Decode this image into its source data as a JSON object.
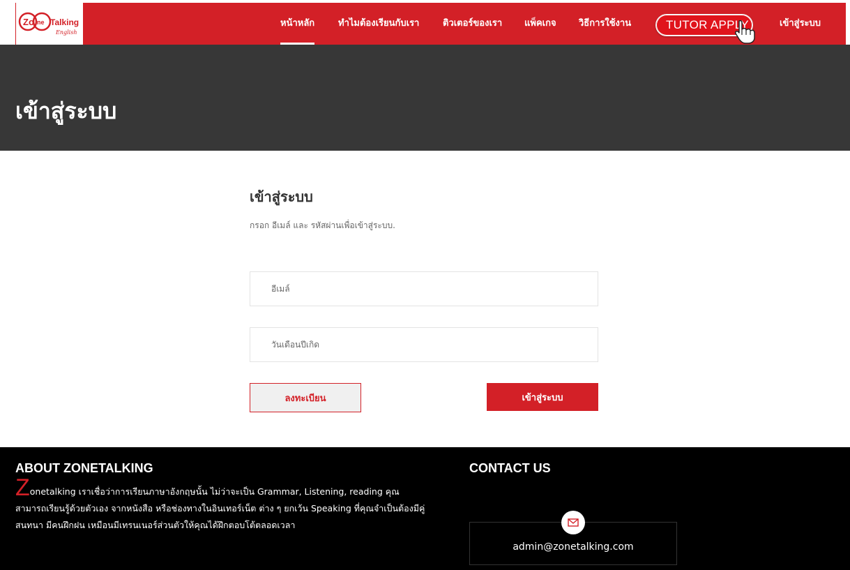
{
  "brand": {
    "logo_text": "ZoneTalking",
    "logo_sub": "English",
    "accent_color": "#d32027",
    "hero_bg": "#373737"
  },
  "nav": {
    "items": [
      {
        "label": "หน้าหลัก",
        "active": true
      },
      {
        "label": "ทำไมต้องเรียนกับเรา"
      },
      {
        "label": "ติวเตอร์ของเรา"
      },
      {
        "label": "แพ็คเกจ"
      },
      {
        "label": "วิธีการใช้งาน"
      },
      {
        "label": "เข้าสู่ระบบ"
      }
    ],
    "tutor_apply": "TUTOR APPLY"
  },
  "hero": {
    "title": "เข้าสู่ระบบ"
  },
  "form": {
    "title": "เข้าสู่ระบบ",
    "description": "กรอก อีเมล์ และ รหัสผ่านเพื่อเข้าสู่ระบบ.",
    "email_placeholder": "อีเมล์",
    "password_placeholder": "วันเดือนปีเกิด",
    "register_label": "ลงทะเบียน",
    "login_label": "เข้าสู่ระบบ"
  },
  "footer": {
    "about_title": "ABOUT ZONETALKING",
    "about_first_letter": "Z",
    "about_text": "onetalking เราเชื่อว่าการเรียนภาษาอังกฤษนั้น ไม่ว่าจะเป็น Grammar, Listening, reading คุณสามารถเรียนรู้ด้วยตัวเอง จากหนังสือ หรือช่องทางในอินเทอร์เน็ต ต่าง ๆ ยกเว้น Speaking ที่คุณจำเป็นต้องมีคู่สนทนา มีคนฝึกฝน เหมือนมีเทรนเนอร์ส่วนตัวให้คุณได้ฝึกตอบโต้ตลอดเวลา",
    "contact_title": "CONTACT US",
    "contact_email": "admin@zonetalking.com",
    "mail_icon": "envelope-icon"
  }
}
